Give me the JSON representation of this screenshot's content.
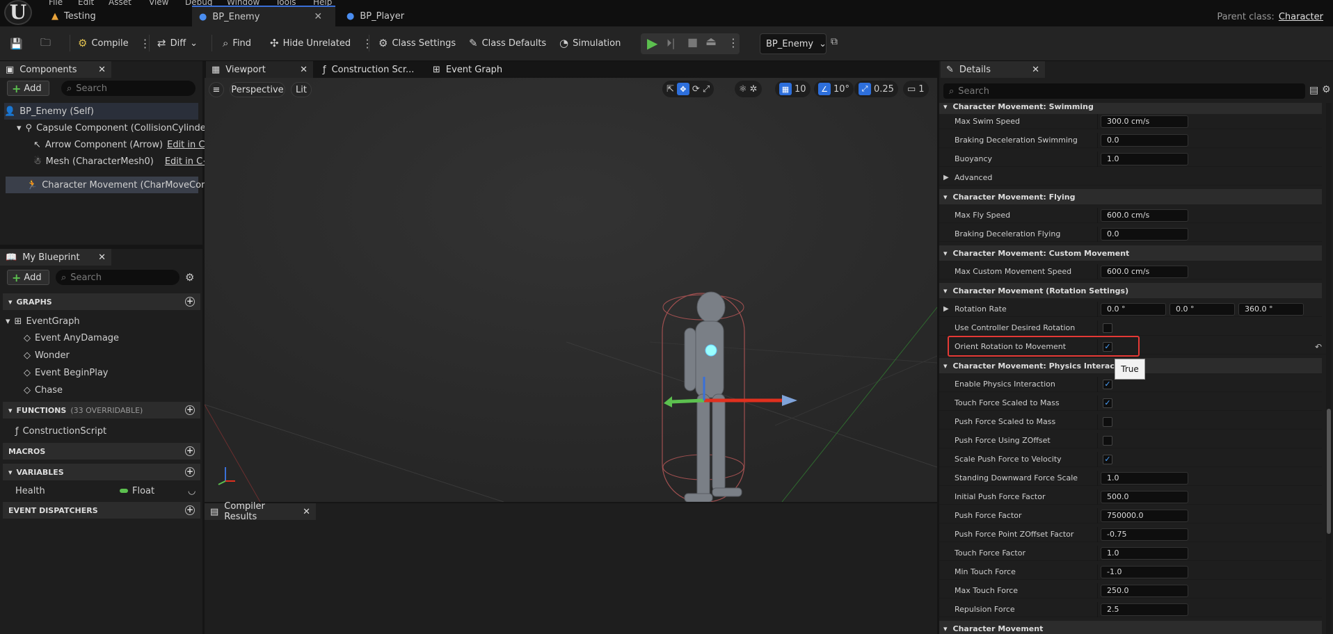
{
  "app": {
    "menu": [
      "File",
      "Edit",
      "Asset",
      "View",
      "Debug",
      "Window",
      "Tools",
      "Help"
    ],
    "tabs": [
      {
        "label": "Testing",
        "active": false
      },
      {
        "label": "BP_Enemy",
        "active": true
      },
      {
        "label": "BP_Player",
        "active": false
      }
    ],
    "parent_class_label": "Parent class:",
    "parent_class_value": "Character"
  },
  "toolbar": {
    "compile": "Compile",
    "diff": "Diff",
    "find": "Find",
    "hide_unrelated": "Hide Unrelated",
    "class_settings": "Class Settings",
    "class_defaults": "Class Defaults",
    "simulation": "Simulation",
    "debug_object": "BP_Enemy"
  },
  "components": {
    "tab_label": "Components",
    "add_label": "Add",
    "search_placeholder": "Search",
    "items": [
      {
        "label": "BP_Enemy (Self)",
        "edit": ""
      },
      {
        "label": "Capsule Component (CollisionCylinder)",
        "edit": ""
      },
      {
        "label": "Arrow Component (Arrow)",
        "edit": "Edit in C++"
      },
      {
        "label": "Mesh (CharacterMesh0)",
        "edit": "Edit in C++"
      },
      {
        "label": "Character Movement (CharMoveComp)",
        "edit": ""
      }
    ]
  },
  "my_blueprint": {
    "tab_label": "My Blueprint",
    "add_label": "Add",
    "search_placeholder": "Search",
    "graphs_label": "GRAPHS",
    "event_graph": "EventGraph",
    "events": [
      "Event AnyDamage",
      "Wonder",
      "Event BeginPlay",
      "Chase"
    ],
    "functions_label": "FUNCTIONS",
    "functions_sub": "(33 OVERRIDABLE)",
    "construction_script": "ConstructionScript",
    "macros_label": "MACROS",
    "variables_label": "VARIABLES",
    "variable_name": "Health",
    "variable_type": "Float",
    "dispatchers_label": "EVENT DISPATCHERS"
  },
  "center_tabs": {
    "viewport": "Viewport",
    "construction": "Construction Scr...",
    "event_graph": "Event Graph",
    "perspective": "Perspective",
    "lit": "Lit",
    "grid_snap": "10",
    "rot_snap": "10°",
    "scale_snap": "0.25",
    "camera_speed": "1",
    "compiler_results": "Compiler Results"
  },
  "details": {
    "tab_label": "Details",
    "search_placeholder": "Search",
    "tooltip": "True",
    "sections": [
      {
        "title": "Character Movement: Swimming",
        "rows": [
          {
            "label": "Max Swim Speed",
            "value": "300.0 cm/s"
          },
          {
            "label": "Braking Deceleration Swimming",
            "value": "0.0"
          },
          {
            "label": "Buoyancy",
            "value": "1.0"
          }
        ]
      },
      {
        "title": "Advanced"
      },
      {
        "title": "Character Movement: Flying",
        "rows": [
          {
            "label": "Max Fly Speed",
            "value": "600.0 cm/s"
          },
          {
            "label": "Braking Deceleration Flying",
            "value": "0.0"
          }
        ]
      },
      {
        "title": "Character Movement: Custom Movement",
        "rows": [
          {
            "label": "Max Custom Movement Speed",
            "value": "600.0 cm/s"
          }
        ]
      },
      {
        "title": "Character Movement (Rotation Settings)",
        "rows": [
          {
            "label": "Rotation Rate",
            "values": [
              "0.0 °",
              "0.0 °",
              "360.0 °"
            ]
          },
          {
            "label": "Use Controller Desired Rotation",
            "checked": false
          },
          {
            "label": "Orient Rotation to Movement",
            "checked": true
          }
        ]
      },
      {
        "title": "Character Movement: Physics Interaction",
        "rows": [
          {
            "label": "Enable Physics Interaction",
            "checked": true
          },
          {
            "label": "Touch Force Scaled to Mass",
            "checked": true
          },
          {
            "label": "Push Force Scaled to Mass",
            "checked": false
          },
          {
            "label": "Push Force Using ZOffset",
            "checked": false
          },
          {
            "label": "Scale Push Force to Velocity",
            "checked": true
          },
          {
            "label": "Standing Downward Force Scale",
            "value": "1.0"
          },
          {
            "label": "Initial Push Force Factor",
            "value": "500.0"
          },
          {
            "label": "Push Force Factor",
            "value": "750000.0"
          },
          {
            "label": "Push Force Point ZOffset Factor",
            "value": "-0.75"
          },
          {
            "label": "Touch Force Factor",
            "value": "1.0"
          },
          {
            "label": "Min Touch Force",
            "value": "-1.0"
          },
          {
            "label": "Max Touch Force",
            "value": "250.0"
          },
          {
            "label": "Repulsion Force",
            "value": "2.5"
          }
        ]
      },
      {
        "title": "Character Movement"
      }
    ]
  },
  "colors": {
    "accent": "#3a70d8",
    "highlight_box": "#e53935",
    "play_green": "#5cc04f"
  }
}
